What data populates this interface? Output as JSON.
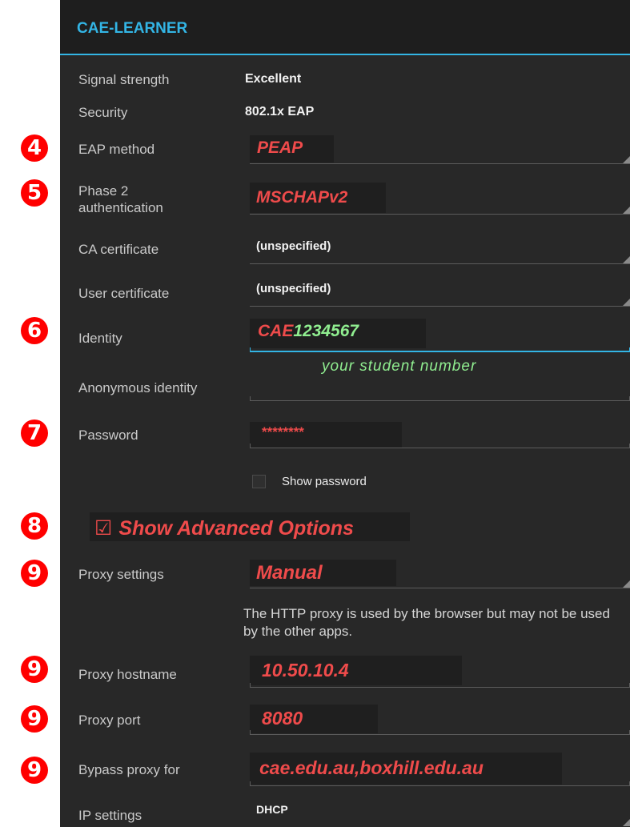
{
  "header": {
    "title": "CAE-LEARNER"
  },
  "info": [
    {
      "label": "Signal strength",
      "value": "Excellent"
    },
    {
      "label": "Security",
      "value": "802.1x EAP"
    }
  ],
  "eap_method": {
    "label": "EAP method",
    "value": "PEAP",
    "badge": "4"
  },
  "phase2": {
    "label": "Phase 2\nauthentication",
    "value": "MSCHAPv2",
    "badge": "5"
  },
  "ca_cert": {
    "label": "CA certificate",
    "value": "(unspecified)"
  },
  "user_cert": {
    "label": "User certificate",
    "value": "(unspecified)"
  },
  "identity": {
    "label": "Identity",
    "prefix": "CAE",
    "number": "1234567",
    "badge": "6",
    "note": "your student number"
  },
  "anon_identity": {
    "label": "Anonymous identity",
    "value": ""
  },
  "password": {
    "label": "Password",
    "value": "********",
    "badge": "7"
  },
  "show_password": {
    "label": "Show password",
    "checked": false
  },
  "advanced": {
    "label": "Show Advanced Options",
    "checked": true,
    "badge": "8"
  },
  "proxy_settings": {
    "label": "Proxy settings",
    "value": "Manual",
    "badge": "9"
  },
  "proxy_note": "The HTTP proxy is used by the browser but may not be used by the other apps.",
  "proxy_hostname": {
    "label": "Proxy hostname",
    "value": "10.50.10.4",
    "badge": "9"
  },
  "proxy_port": {
    "label": "Proxy port",
    "value": "8080",
    "badge": "9"
  },
  "bypass": {
    "label": "Bypass proxy for",
    "value": "cae.edu.au,boxhill.edu.au",
    "badge": "9"
  },
  "ip_settings": {
    "label": "IP settings",
    "value": "DHCP"
  },
  "colors": {
    "accent": "#33b5e5",
    "annotation": "#ef4b4b",
    "badge": "#ff0000",
    "note": "#90ee90",
    "background": "#282828"
  }
}
